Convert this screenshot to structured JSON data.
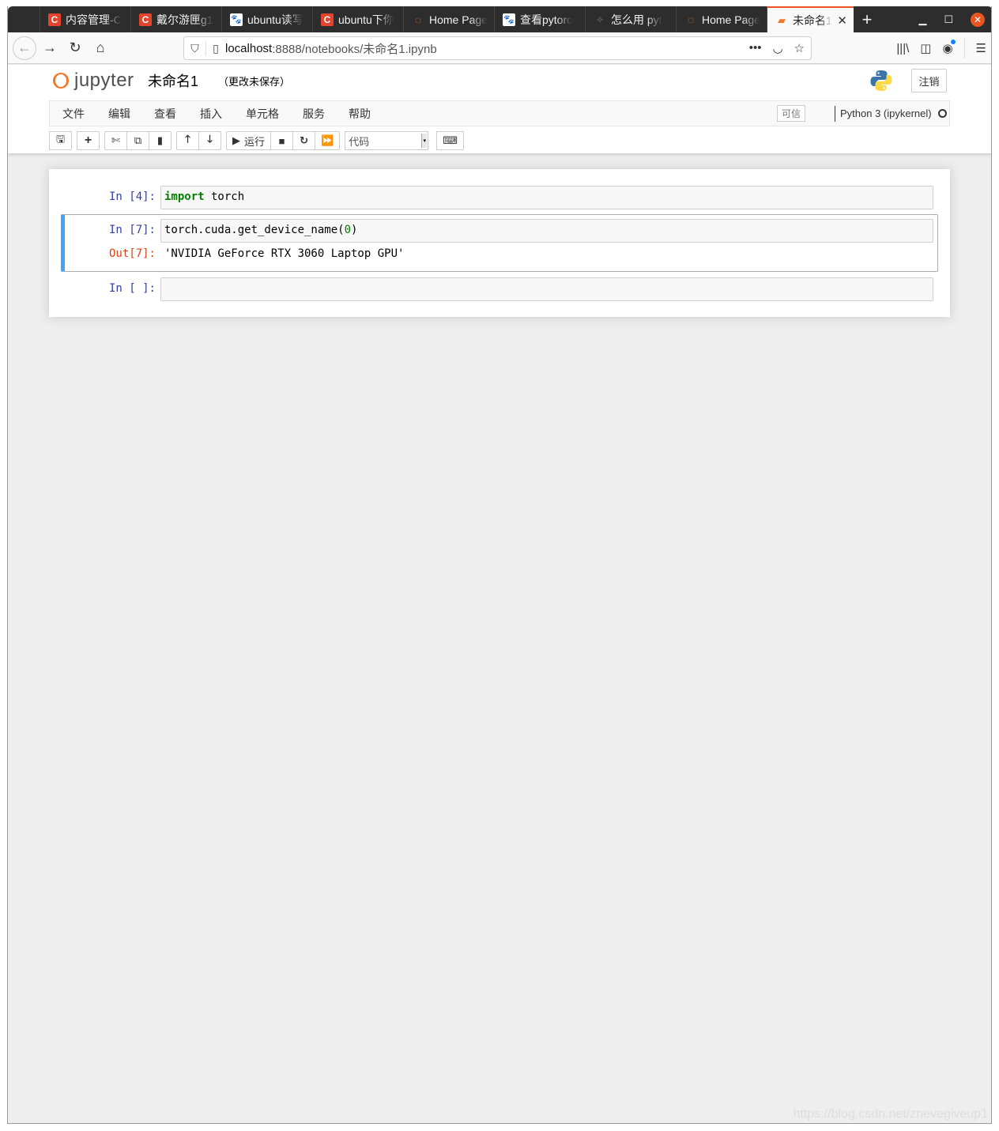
{
  "browser": {
    "tabs": [
      {
        "label": "内容管理-C",
        "favicon": "csdn-icon",
        "active": false
      },
      {
        "label": "戴尔游匣g1",
        "favicon": "csdn-icon",
        "active": false
      },
      {
        "label": "ubuntu读写",
        "favicon": "baidu-icon",
        "active": false
      },
      {
        "label": "ubuntu下你",
        "favicon": "csdn-icon",
        "active": false
      },
      {
        "label": "Home Page",
        "favicon": "jupyter-icon",
        "active": false
      },
      {
        "label": "查看pytorc",
        "favicon": "baidu-icon",
        "active": false
      },
      {
        "label": "怎么用 pyt",
        "favicon": "generic-icon",
        "active": false
      },
      {
        "label": "Home Page",
        "favicon": "jupyter-icon",
        "active": false
      },
      {
        "label": "未命名1",
        "favicon": "notebook-icon",
        "active": true
      }
    ],
    "new_tab_label": "+",
    "close_tab_glyph": "✕",
    "url": {
      "host": "localhost",
      "rest": ":8888/notebooks/未命名1.ipynb"
    },
    "accent_color": "#e95420",
    "notification_dot_color": "#0a84ff"
  },
  "jupyter": {
    "logo_text": "jupyter",
    "notebook_name": "未命名1",
    "save_status": "（更改未保存）",
    "logout_label": "注销",
    "menu": [
      "文件",
      "编辑",
      "查看",
      "插入",
      "单元格",
      "服务",
      "帮助"
    ],
    "trusted_label": "可信",
    "kernel_name": "Python 3 (ipykernel)",
    "kernel_status": "idle",
    "toolbar": {
      "run_label": "运行",
      "cell_type": "代码"
    },
    "brand_color": "#f37726"
  },
  "cells": [
    {
      "prompt": "In [4]:",
      "code_keyword": "import",
      "code_rest": " torch",
      "selected": false
    },
    {
      "prompt": "In [7]:",
      "code_before": "torch.cuda.get_device_name(",
      "code_number": "0",
      "code_after": ")",
      "out_prompt": "Out[7]:",
      "output": "'NVIDIA GeForce RTX 3060 Laptop GPU'",
      "selected": true
    },
    {
      "prompt": "In [ ]:",
      "code": "",
      "selected": false
    }
  ],
  "selection_color": "#42a5f5",
  "watermark": "https://blog.csdn.net/znevegiveup1"
}
